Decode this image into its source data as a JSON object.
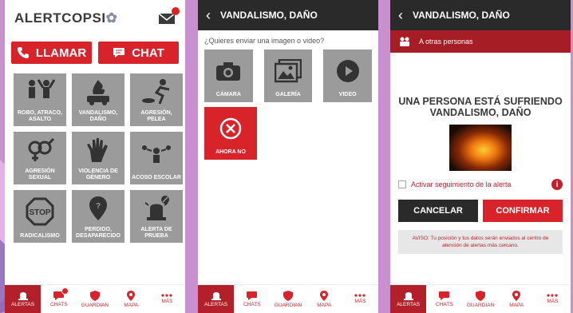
{
  "screen1": {
    "logo_text": "ALERTCOPSI",
    "call_label": "LLAMAR",
    "chat_label": "CHAT",
    "tiles": [
      {
        "label": "ROBO, ATRACO,\nASALTO",
        "icon": "robbery-icon"
      },
      {
        "label": "VANDALISMO,\nDAÑO",
        "icon": "vandalism-icon"
      },
      {
        "label": "AGRESIÓN,\nPELEA",
        "icon": "fight-icon"
      },
      {
        "label": "AGRESIÓN\nSEXUAL",
        "icon": "gender-icon"
      },
      {
        "label": "VIOLENCIA DE\nGÉNERO",
        "icon": "hand-icon"
      },
      {
        "label": "ACOSO ESCOLAR",
        "icon": "bullying-icon"
      },
      {
        "label": "RADICALISMO",
        "icon": "stop-icon"
      },
      {
        "label": "PERDIDO,\nDESAPARECIDO",
        "icon": "location-pin-icon"
      },
      {
        "label": "ALERTA DE\nPRUEBA",
        "icon": "siren-icon"
      }
    ]
  },
  "nav": {
    "items": [
      "ALERTAS",
      "CHATS",
      "GUARDIAN",
      "MAPA",
      "MÁS"
    ]
  },
  "screen2": {
    "title": "VANDALISMO, DAÑO",
    "question": "¿Quieres enviar una imagen o video?",
    "camera_label": "CÁMARA",
    "gallery_label": "GALERÍA",
    "video_label": "VIDEO",
    "skip_label": "AHORA NO"
  },
  "screen3": {
    "title": "VANDALISMO, DAÑO",
    "subbar_label": "A otras personas",
    "message": "UNA PERSONA ESTÁ SUFRIENDO\nVANDALISMO, DAÑO",
    "follow_label": "Activar seguimiento de la alerta",
    "cancel_label": "CANCELAR",
    "confirm_label": "CONFIRMAR",
    "notice": "AVISO: Tu posición y tus datos serán enviados al centro de atención de alertas más cercano."
  },
  "colors": {
    "accent_red": "#d8232a",
    "dark_red": "#a61d25",
    "tile_gray": "#9b9b9b",
    "header_dark": "#2a2a2a",
    "background": "#c98fcf"
  }
}
